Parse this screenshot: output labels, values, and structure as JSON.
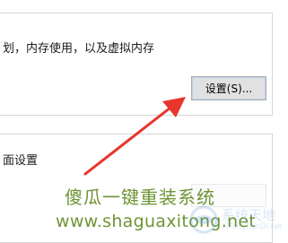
{
  "performance_group": {
    "description": "划，内存使用，以及虚拟内存",
    "settings_button_label": "设置(S)..."
  },
  "startup_group": {
    "description": "面设置"
  },
  "watermark": {
    "title": "傻瓜一键重装系统",
    "url": "www.shaguaxitong.net",
    "brand_cn": "系统天地",
    "brand_en": "XiTongTianDi.net"
  },
  "colors": {
    "arrow": "#e8352c",
    "watermark_text": "#6e9435",
    "brand_logo": "#4a8fd8"
  }
}
